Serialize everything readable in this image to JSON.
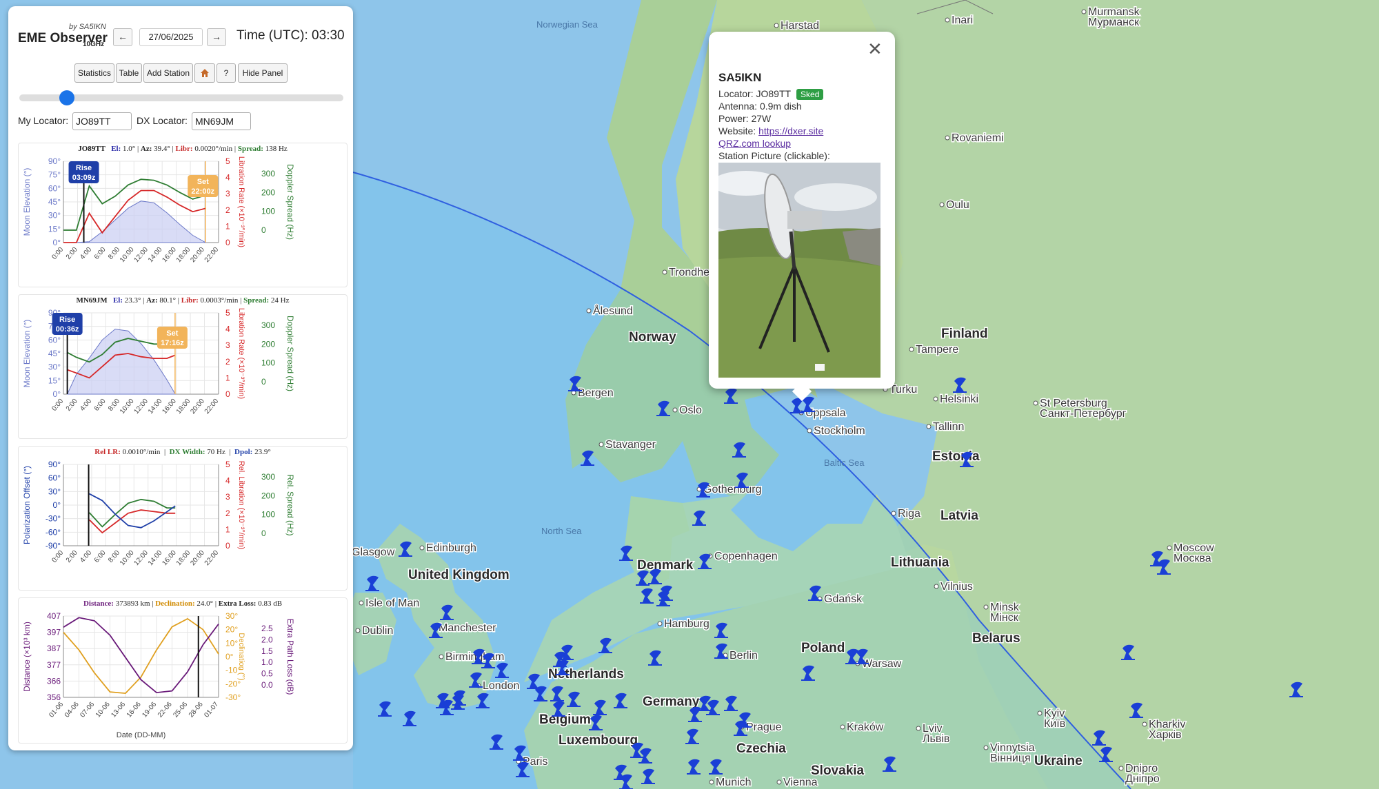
{
  "app": {
    "title": "EME Observer",
    "byline": "by SA5IKN",
    "band": "10GHz",
    "date": "27/06/2025",
    "time": "Time (UTC): 03:30",
    "prev_icon": "left-arrow-icon",
    "next_icon": "right-arrow-icon"
  },
  "toolbar": {
    "statistics": "Statistics",
    "table": "Table",
    "add_station": "Add Station",
    "home_icon": "home-icon",
    "help": "?",
    "hide_panel": "Hide Panel"
  },
  "time_slider": {
    "hour": 3.5,
    "range": [
      0,
      24
    ]
  },
  "locators": {
    "my_label": "My Locator:",
    "my_value": "JO89TT",
    "dx_label": "DX Locator:",
    "dx_value": "MN69JM"
  },
  "colors": {
    "accent": "#1a73e8",
    "elevation": "#6b78c8",
    "libration": "#d62728",
    "spread": "#2e7d32",
    "rise_badge": "#1f3fa8",
    "set_badge": "#f2b45a",
    "polarization": "#1f3fa8",
    "distance": "#6a1b7a",
    "declination": "#e0a020",
    "station": "#1a3fd6",
    "sked_badge": "#2e9e44"
  },
  "chart1": {
    "station": "JO89TT",
    "el_label": "El:",
    "el": "1.0°",
    "az_label": "Az:",
    "az": "39.4°",
    "libr_label": "Libr:",
    "libr": "0.0020°/min",
    "spread_label": "Spread:",
    "spread": "138 Hz",
    "rise_title": "Rise",
    "rise_time": "03:09z",
    "set_title": "Set",
    "set_time": "22:00z"
  },
  "chart2": {
    "station": "MN69JM",
    "el_label": "El:",
    "el": "23.3°",
    "az_label": "Az:",
    "az": "80.1°",
    "libr_label": "Libr:",
    "libr": "0.0003°/min",
    "spread_label": "Spread:",
    "spread": "24 Hz",
    "rise_title": "Rise",
    "rise_time": "00:36z",
    "set_title": "Set",
    "set_time": "17:16z"
  },
  "chart3": {
    "rel_lr_label": "Rel LR:",
    "rel_lr": "0.0010°/min",
    "dx_width_label": "DX Width:",
    "dx_width": "70 Hz",
    "dpol_label": "Dpol:",
    "dpol": "23.9°"
  },
  "chart4": {
    "distance_label": "Distance:",
    "distance": "373893 km",
    "declination_label": "Declination:",
    "declination": "24.0°",
    "extra_loss_label": "Extra Loss:",
    "extra_loss": "0.83 dB"
  },
  "axis_labels": {
    "moon_elev": "Moon Elevation (°)",
    "libr_rate": "Libration Rate (×10⁻³°/min)",
    "doppler": "Doppler Spread (Hz)",
    "pol_offset": "Polarization Offset (°)",
    "rel_libr": "Rel. Libration (×10⁻³°/min)",
    "rel_spread": "Rel. Spread (Hz)",
    "distance": "Distance (×10³ km)",
    "declination": "Declination (°)",
    "extra_loss": "Extra Path Loss (dB)",
    "date": "Date (DD-MM)"
  },
  "chart_data": [
    {
      "type": "line",
      "id": "jo89tt",
      "x_ticks": [
        "0:00",
        "2:00",
        "4:00",
        "6:00",
        "8:00",
        "10:00",
        "12:00",
        "14:00",
        "16:00",
        "18:00",
        "20:00",
        "22:00"
      ],
      "ylim_left": [
        0,
        90
      ],
      "y_ticks_left": [
        "90°",
        "75°",
        "60°",
        "45°",
        "30°",
        "15°",
        "0°"
      ],
      "ylim_mid": [
        0,
        5
      ],
      "y_ticks_mid": [
        "5",
        "4",
        "3",
        "2",
        "1",
        "0"
      ],
      "ylim_right": [
        0,
        300
      ],
      "y_ticks_right": [
        "300",
        "200",
        "100",
        "0"
      ],
      "x": [
        0,
        2,
        4,
        6,
        8,
        10,
        12,
        14,
        16,
        18,
        20,
        22
      ],
      "elevation": [
        0,
        0,
        1,
        12,
        25,
        38,
        46,
        44,
        33,
        20,
        8,
        0
      ],
      "libration": [
        0,
        0,
        1.8,
        0.6,
        1.6,
        2.6,
        3.2,
        3.2,
        2.8,
        2.3,
        1.9,
        2.1
      ],
      "spread": [
        0,
        0,
        235,
        140,
        180,
        240,
        270,
        265,
        240,
        200,
        165,
        185
      ],
      "rise": 3.15,
      "set": 22.0
    },
    {
      "type": "line",
      "id": "mn69jm",
      "x_ticks": [
        "0:00",
        "2:00",
        "4:00",
        "6:00",
        "8:00",
        "10:00",
        "12:00",
        "14:00",
        "16:00",
        "18:00",
        "20:00",
        "22:00"
      ],
      "ylim_left": [
        0,
        90
      ],
      "y_ticks_left": [
        "90°",
        "75°",
        "60°",
        "45°",
        "30°",
        "15°",
        "0°"
      ],
      "ylim_mid": [
        0,
        5
      ],
      "y_ticks_mid": [
        "5",
        "4",
        "3",
        "2",
        "1",
        "0"
      ],
      "ylim_right": [
        0,
        300
      ],
      "y_ticks_right": [
        "300",
        "200",
        "100",
        "0"
      ],
      "x": [
        0.6,
        2,
        4,
        6,
        8,
        10,
        12,
        14,
        16,
        17.3
      ],
      "elevation": [
        0,
        22,
        40,
        60,
        72,
        70,
        56,
        38,
        16,
        0
      ],
      "libration": [
        1.5,
        1.3,
        1.0,
        1.7,
        2.4,
        2.5,
        2.3,
        2.2,
        2.2,
        2.4
      ],
      "spread": [
        155,
        130,
        105,
        145,
        210,
        230,
        215,
        200,
        200,
        210
      ],
      "rise": 0.6,
      "set": 17.27
    },
    {
      "type": "line",
      "id": "relative",
      "x_ticks": [
        "0:00",
        "2:00",
        "4:00",
        "6:00",
        "8:00",
        "10:00",
        "12:00",
        "14:00",
        "16:00",
        "18:00",
        "20:00",
        "22:00"
      ],
      "ylim_left": [
        -90,
        90
      ],
      "y_ticks_left": [
        "90°",
        "60°",
        "30°",
        "0°",
        "-30°",
        "-60°",
        "-90°"
      ],
      "ylim_mid": [
        0,
        5
      ],
      "y_ticks_mid": [
        "5",
        "4",
        "3",
        "2",
        "1",
        "0"
      ],
      "ylim_right": [
        0,
        300
      ],
      "y_ticks_right": [
        "300",
        "200",
        "100",
        "0"
      ],
      "x": [
        4,
        6,
        8,
        10,
        12,
        14,
        16,
        17.3
      ],
      "polarization": [
        25,
        10,
        -20,
        -45,
        -50,
        -35,
        -15,
        -2
      ],
      "rel_libration": [
        1.6,
        0.8,
        1.4,
        2.0,
        2.2,
        2.1,
        2.0,
        2.0
      ],
      "rel_spread": [
        110,
        35,
        100,
        160,
        180,
        170,
        135,
        135
      ],
      "marker": 3.9
    },
    {
      "type": "line",
      "id": "moon",
      "x_ticks": [
        "01-06",
        "04-06",
        "07-06",
        "10-06",
        "13-06",
        "16-06",
        "19-06",
        "22-06",
        "25-06",
        "28-06",
        "01-07"
      ],
      "ylim_left": [
        356,
        407
      ],
      "y_ticks_left": [
        "407",
        "397",
        "387",
        "377",
        "366",
        "356"
      ],
      "ylim_mid": [
        -30,
        30
      ],
      "y_ticks_mid": [
        "30°",
        "20°",
        "10°",
        "0°",
        "-10°",
        "-20°",
        "-30°"
      ],
      "ylim_right": [
        0,
        2.5
      ],
      "y_ticks_right": [
        "2.5",
        "2.0",
        "1.5",
        "1.0",
        "0.5",
        "0.0"
      ],
      "x": [
        0,
        3,
        6,
        9,
        12,
        15,
        18,
        21,
        24,
        27,
        30
      ],
      "distance": [
        400,
        406,
        404,
        395,
        381,
        367,
        359,
        360,
        372,
        389,
        402
      ],
      "declination": [
        18,
        5,
        -12,
        -26,
        -27,
        -15,
        5,
        22,
        28,
        20,
        2
      ],
      "marker": 26.1
    }
  ],
  "map": {
    "seas": [
      {
        "name": "Norwegian Sea"
      },
      {
        "name": "North Sea"
      },
      {
        "name": "Baltic Sea"
      }
    ],
    "countries": [
      "Norway",
      "Finland",
      "Denmark",
      "Lithuania",
      "Latvia",
      "Estonia",
      "United Kingdom",
      "Poland",
      "Belarus",
      "Germany",
      "Belgium",
      "Czechia",
      "Slovakia",
      "Ukraine",
      "Netherlands",
      "Luxembourg"
    ],
    "cities": [
      "Bergen",
      "Oslo",
      "Stavanger",
      "Uppsala",
      "Stockholm",
      "Gothenburg",
      "Copenhagen",
      "Edinburgh",
      "Glasgow",
      "Isle of Man",
      "Manchester",
      "Dublin",
      "Birmingham",
      "London",
      "Paris",
      "Hamburg",
      "Berlin",
      "Gdańsk",
      "Warsaw",
      "Kraków",
      "Prague",
      "Vienna",
      "Munich",
      "Riga",
      "Tallinn",
      "Helsinki",
      "Turku",
      "Tampere",
      "Oulu",
      "Rovaniemi",
      "Ålesund",
      "Trondheim",
      "Vilnius",
      "Minsk\nМінск",
      "Lviv\nЛьвів",
      "Vinnytsia\nВінниця",
      "Kyiv\nКиїв",
      "Kharkiv\nХарків",
      "Dnipro\nДніпро",
      "St Petersburg\nСанкт-Петербург",
      "Moscow\nМосква",
      "Murmansk\nМурманск",
      "Inari",
      "Harstad"
    ],
    "station_icon": "satellite-dish-icon"
  },
  "popup": {
    "name": "SA5IKN",
    "locator": "Locator: JO89TT",
    "status": "Sked",
    "antenna": "Antenna: 0.9m dish",
    "power": "Power: 27W",
    "website_label": "Website:",
    "website": "https://dxer.site",
    "qrz": "QRZ.com lookup",
    "picture_label": "Station Picture (clickable):",
    "close_icon": "close-icon"
  }
}
